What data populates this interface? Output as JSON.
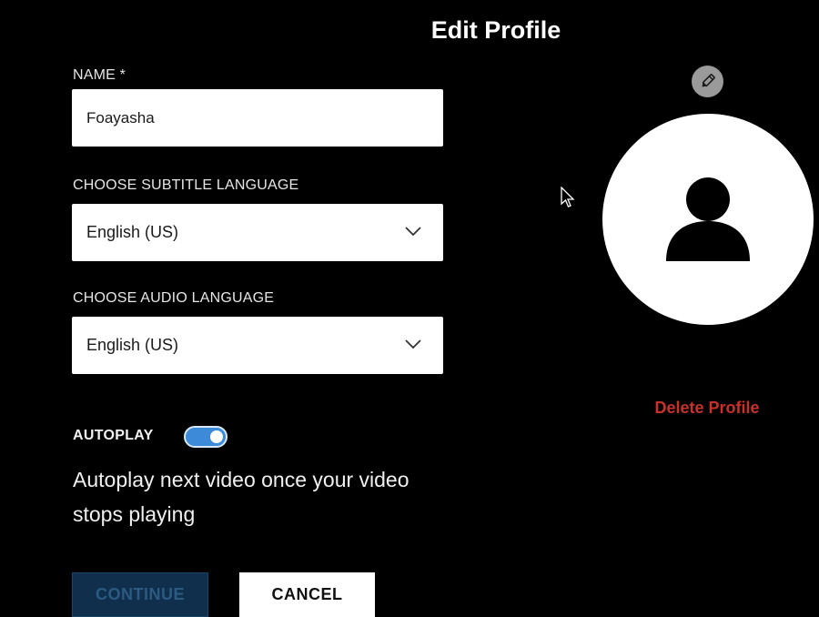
{
  "page": {
    "title": "Edit Profile"
  },
  "form": {
    "name": {
      "label": "NAME *",
      "value": "Foayasha"
    },
    "subtitle_language": {
      "label": "CHOOSE SUBTITLE LANGUAGE",
      "selected": "English (US)",
      "icon": "chevron-down-icon"
    },
    "audio_language": {
      "label": "CHOOSE AUDIO LANGUAGE",
      "selected": "English (US)",
      "icon": "chevron-down-icon"
    },
    "autoplay": {
      "label": "AUTOPLAY",
      "enabled": true,
      "description": "Autoplay next video once your video stops playing"
    }
  },
  "actions": {
    "continue_label": "CONTINUE",
    "cancel_label": "CANCEL",
    "continue_disabled": true
  },
  "avatar": {
    "edit_icon": "pencil-icon",
    "placeholder_icon": "person-icon",
    "delete_label": "Delete Profile"
  },
  "colors": {
    "background": "#000000",
    "toggle_on": "#3d8bd8",
    "delete_text": "#c8302c",
    "continue_disabled_bg": "#0f2f4c",
    "continue_disabled_text": "#2c5a80"
  }
}
